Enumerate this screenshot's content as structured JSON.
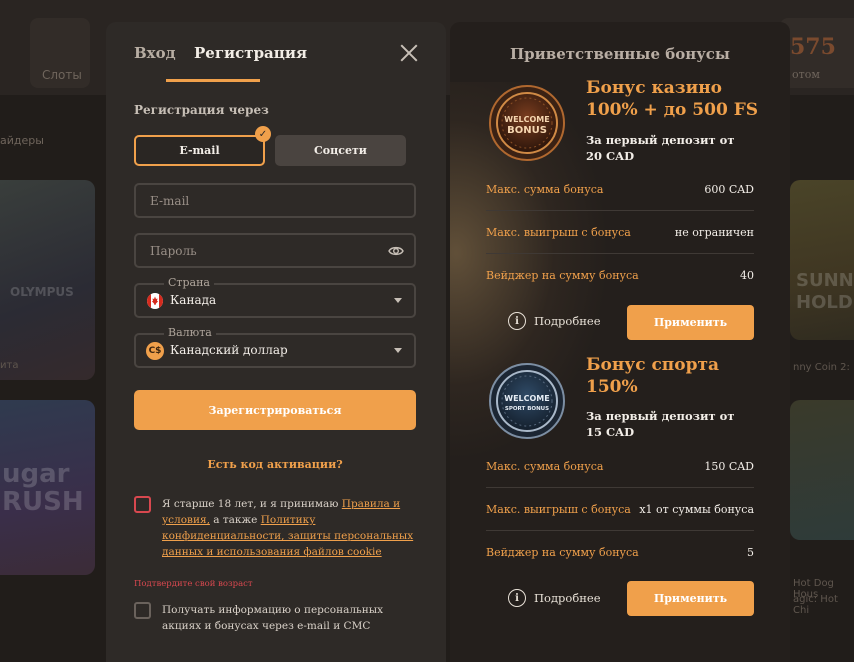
{
  "background": {
    "slots_label": "Слоты",
    "right_number": "575",
    "right_small": "отом",
    "providers_label": "айдеры",
    "game_texts": [
      "OLYMPUS",
      "ugar RUSH",
      "SUNN HOLD"
    ],
    "captions": [
      "ита",
      "nny Coin 2:",
      "Hot Dog Hous",
      "agic: Hot Chi"
    ]
  },
  "modal": {
    "tab_login": "Вход",
    "tab_register": "Регистрация",
    "register_via": "Регистрация через",
    "method_email": "E-mail",
    "method_social": "Соцсети",
    "email_placeholder": "E-mail",
    "password_placeholder": "Пароль",
    "country_label": "Страна",
    "country_value": "Канада",
    "currency_label": "Валюта",
    "currency_value": "Канадский доллар",
    "currency_symbol": "C$",
    "register_button": "Зарегистрироваться",
    "activation_code_link": "Есть код активации?",
    "consent_prefix": "Я старше 18 лет, и я принимаю ",
    "consent_rules_link": "Правила и условия,",
    "consent_middle": " а также ",
    "consent_privacy_link": "Политику конфиденциальности, защиты персональных данных и использования файлов cookie",
    "age_error": "Подтвердите свой возраст",
    "promo_consent": "Получать информацию о персональных акциях и бонусах через e-mail и СМС"
  },
  "bonuses": {
    "title": "Приветственные бонусы",
    "casino": {
      "badge_text_1": "WELCOME",
      "badge_text_2": "BONUS",
      "name_line1": "Бонус казино",
      "name_line2": "100% + до 500 FS",
      "sub_line1": "За первый депозит от",
      "sub_line2": "20 CAD",
      "rows": [
        {
          "label": "Макс. сумма бонуса",
          "value": "600 CAD"
        },
        {
          "label": "Макс. выигрыш с бонуса",
          "value": "не ограничен"
        },
        {
          "label": "Вейджер на сумму бонуса",
          "value": "40"
        }
      ],
      "details": "Подробнее",
      "apply": "Применить"
    },
    "sport": {
      "badge_text_1": "WELCOME",
      "badge_text_2": "SPORT BONUS",
      "name_line1": "Бонус спорта",
      "name_line2": "150%",
      "sub_line1": "За первый депозит от",
      "sub_line2": "15 CAD",
      "rows": [
        {
          "label": "Макс. сумма бонуса",
          "value": "150 CAD"
        },
        {
          "label": "Макс. выигрыш с бонуса",
          "value": "x1 от суммы бонуса"
        },
        {
          "label": "Вейджер на сумму бонуса",
          "value": "5"
        }
      ],
      "details": "Подробнее",
      "apply": "Применить"
    }
  },
  "colors": {
    "accent": "#f0a04b",
    "error": "#d8484f",
    "modal_bg": "#2e2a27",
    "panel_bg": "#241f1c"
  },
  "icons": {
    "close": "close-icon",
    "check": "check-icon",
    "eye": "eye-icon",
    "flag": "canada-flag-icon",
    "currency": "currency-icon",
    "caret": "chevron-down-icon",
    "info": "info-icon"
  }
}
